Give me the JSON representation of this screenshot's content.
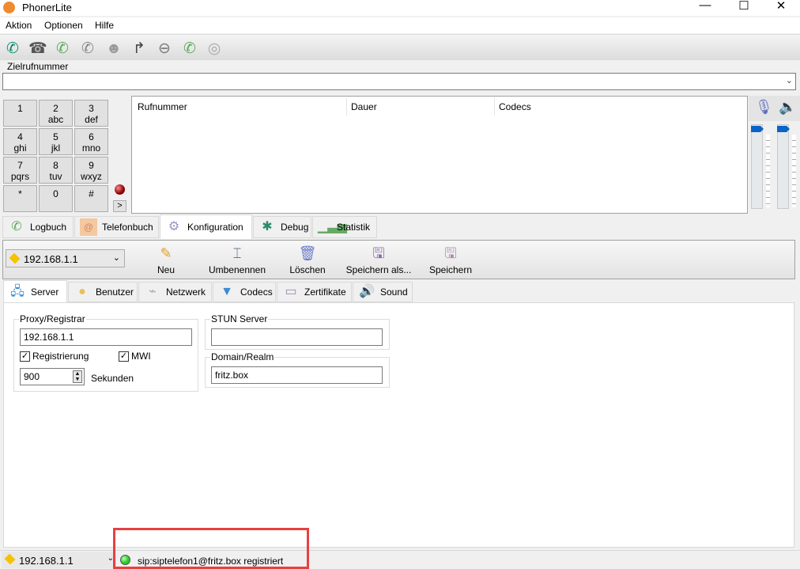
{
  "window": {
    "title": "PhonerLite",
    "controls": {
      "minimize": "—",
      "maximize": "☐",
      "close": "✕"
    }
  },
  "menu": [
    "Aktion",
    "Optionen",
    "Hilfe"
  ],
  "toolbar_icons": [
    "call-icon",
    "hangup-icon",
    "callback-icon",
    "hold-icon",
    "conference-icon",
    "forward-icon",
    "reject-icon",
    "call-wait-icon",
    "anonymous-icon"
  ],
  "destination": {
    "label": "Zielrufnummer",
    "value": ""
  },
  "dialpad": [
    {
      "d": "1",
      "l": ""
    },
    {
      "d": "2",
      "l": "abc"
    },
    {
      "d": "3",
      "l": "def"
    },
    {
      "d": "4",
      "l": "ghi"
    },
    {
      "d": "5",
      "l": "jkl"
    },
    {
      "d": "6",
      "l": "mno"
    },
    {
      "d": "7",
      "l": "pqrs"
    },
    {
      "d": "8",
      "l": "tuv"
    },
    {
      "d": "9",
      "l": "wxyz"
    },
    {
      "d": "*",
      "l": ""
    },
    {
      "d": "0",
      "l": ""
    },
    {
      "d": "#",
      "l": ""
    }
  ],
  "expand_label": ">",
  "call_list": {
    "columns": [
      "Rufnummer",
      "Dauer",
      "Codecs"
    ]
  },
  "volume": {
    "mic_level": 1.0,
    "speaker_level": 1.0
  },
  "tabs": [
    "Logbuch",
    "Telefonbuch",
    "Konfiguration",
    "Debug",
    "Statistik"
  ],
  "active_tab": "Konfiguration",
  "config_toolbar": {
    "profile": "192.168.1.1",
    "buttons": [
      "Neu",
      "Umbenennen",
      "Löschen",
      "Speichern als...",
      "Speichern"
    ]
  },
  "subtabs": [
    "Server",
    "Benutzer",
    "Netzwerk",
    "Codecs",
    "Zertifikate",
    "Sound"
  ],
  "server": {
    "proxy_label": "Proxy/Registrar",
    "proxy_value": "192.168.1.1",
    "registration_label": "Registrierung",
    "registration_checked": true,
    "mwi_label": "MWI",
    "mwi_checked": true,
    "seconds_value": "900",
    "seconds_label": "Sekunden",
    "stun_label": "STUN Server",
    "stun_value": "",
    "domain_label": "Domain/Realm",
    "domain_value": "fritz.box"
  },
  "status": {
    "profile": "192.168.1.1",
    "text": "sip:siptelefon1@fritz.box registriert",
    "led_color": "#22cc22"
  },
  "colors": {
    "highlight": "#e84040"
  }
}
